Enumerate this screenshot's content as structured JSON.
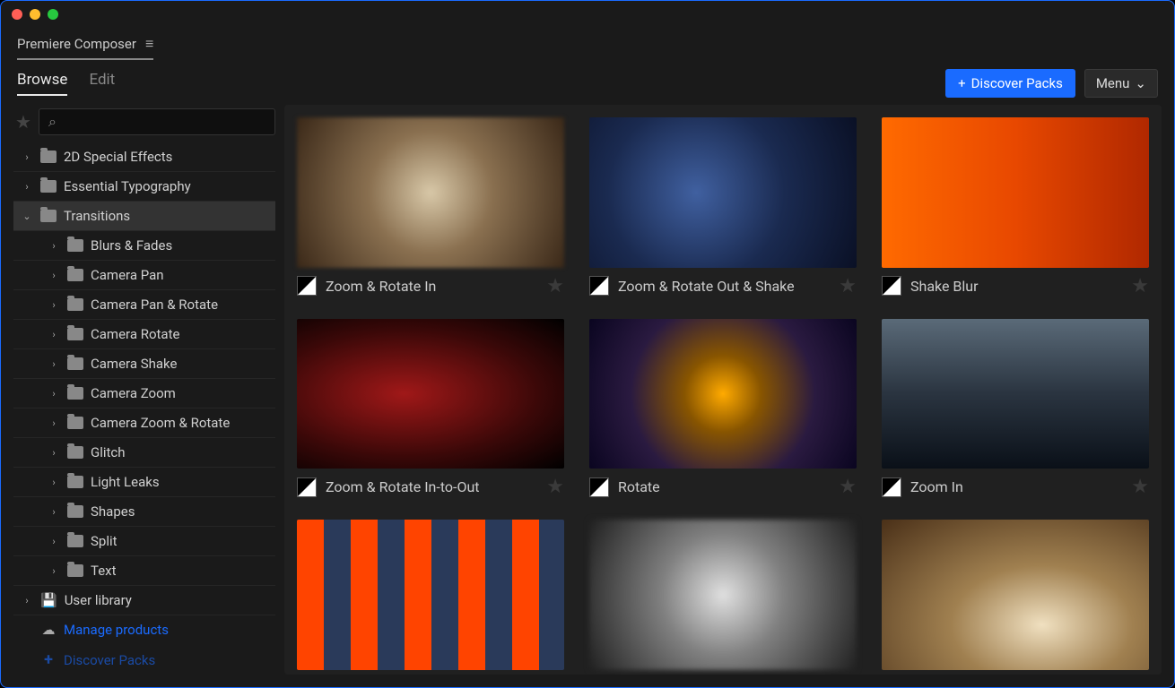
{
  "app": {
    "title": "Premiere Composer"
  },
  "tabs": {
    "browse": "Browse",
    "edit": "Edit"
  },
  "actions": {
    "discover": "Discover Packs",
    "menu": "Menu"
  },
  "search": {
    "placeholder": ""
  },
  "tree": {
    "top": [
      {
        "label": "2D Special Effects"
      },
      {
        "label": "Essential Typography"
      },
      {
        "label": "Transitions"
      }
    ],
    "transitions_children": [
      {
        "label": "Blurs & Fades"
      },
      {
        "label": "Camera Pan"
      },
      {
        "label": "Camera Pan & Rotate"
      },
      {
        "label": "Camera Rotate"
      },
      {
        "label": "Camera Shake"
      },
      {
        "label": "Camera Zoom"
      },
      {
        "label": "Camera Zoom & Rotate"
      },
      {
        "label": "Glitch"
      },
      {
        "label": "Light Leaks"
      },
      {
        "label": "Shapes"
      },
      {
        "label": "Split"
      },
      {
        "label": "Text"
      }
    ],
    "user_library": "User library",
    "manage_products": "Manage products",
    "discover_packs": "Discover Packs"
  },
  "items": [
    {
      "title": "Zoom & Rotate In",
      "thumb": "t1"
    },
    {
      "title": "Zoom & Rotate Out & Shake",
      "thumb": "t2"
    },
    {
      "title": "Shake Blur",
      "thumb": "t3"
    },
    {
      "title": "Zoom & Rotate In-to-Out",
      "thumb": "t4"
    },
    {
      "title": "Rotate",
      "thumb": "t5"
    },
    {
      "title": "Zoom In",
      "thumb": "t6"
    },
    {
      "title": "",
      "thumb": "t7"
    },
    {
      "title": "",
      "thumb": "t8"
    },
    {
      "title": "",
      "thumb": "t9"
    }
  ]
}
